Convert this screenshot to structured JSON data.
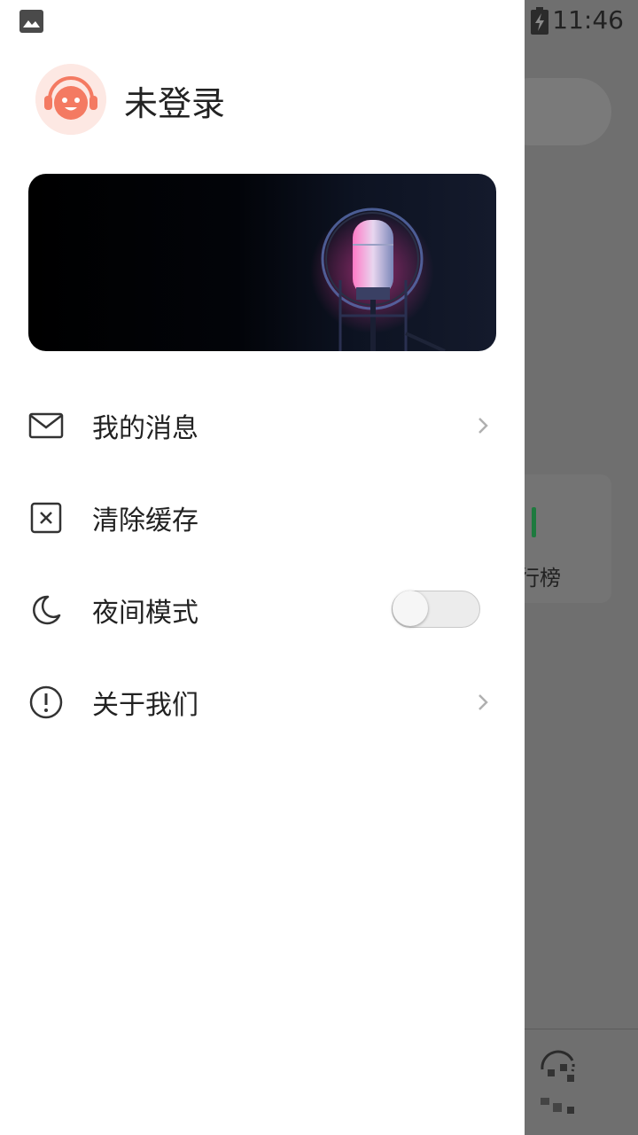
{
  "status_bar": {
    "time": "11:46",
    "icons": [
      "image-icon",
      "data-transfer-icon",
      "no-sim-icon",
      "battery-charging-icon"
    ]
  },
  "drawer": {
    "login_status": "未登录",
    "menu": [
      {
        "label": "我的消息",
        "icon": "mail-icon",
        "trailing": "chevron"
      },
      {
        "label": "清除缓存",
        "icon": "clear-cache-icon",
        "trailing": "none"
      },
      {
        "label": "夜间模式",
        "icon": "moon-icon",
        "trailing": "toggle",
        "toggle_on": false
      },
      {
        "label": "关于我们",
        "icon": "info-icon",
        "trailing": "chevron"
      }
    ]
  },
  "background": {
    "card_label": "行榜"
  },
  "colors": {
    "accent_green": "#1e7a3e",
    "avatar_orange": "#f47a62",
    "mic_pink": "#ff7ac6"
  }
}
